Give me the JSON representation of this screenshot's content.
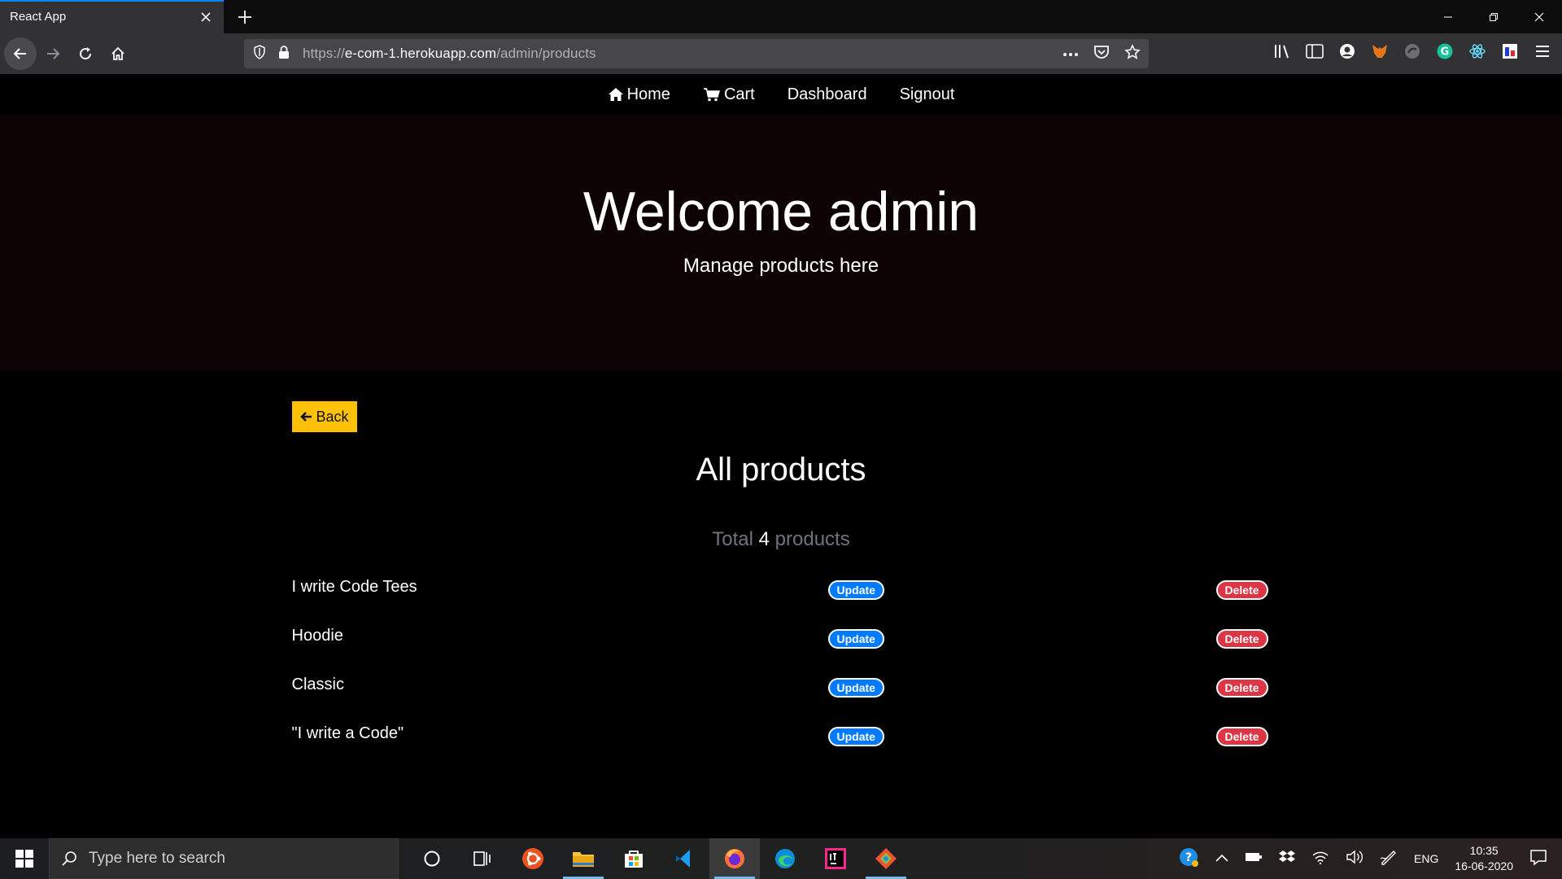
{
  "browser": {
    "tab_title": "React App",
    "url_prefix": "https://",
    "url_host": "e-com-1.herokuapp.com",
    "url_path": "/admin/products"
  },
  "site_nav": {
    "home": "Home",
    "cart": "Cart",
    "dashboard": "Dashboard",
    "signout": "Signout"
  },
  "hero": {
    "title": "Welcome admin",
    "subtitle": "Manage products here"
  },
  "main": {
    "back_label": "Back",
    "section_title": "All products",
    "total_prefix": "Total",
    "total_count": "4",
    "total_suffix": "products",
    "update_label": "Update",
    "delete_label": "Delete",
    "products": [
      {
        "name": "I write Code Tees"
      },
      {
        "name": "Hoodie"
      },
      {
        "name": "Classic"
      },
      {
        "name": "\"I write a Code\""
      }
    ]
  },
  "colors": {
    "back_button": "#ffc107",
    "update_badge": "#007bff",
    "delete_badge": "#dc3545",
    "hero_bg": "#0e0303"
  },
  "taskbar": {
    "search_placeholder": "Type here to search",
    "language": "ENG",
    "time": "10:35",
    "date": "16-06-2020"
  }
}
